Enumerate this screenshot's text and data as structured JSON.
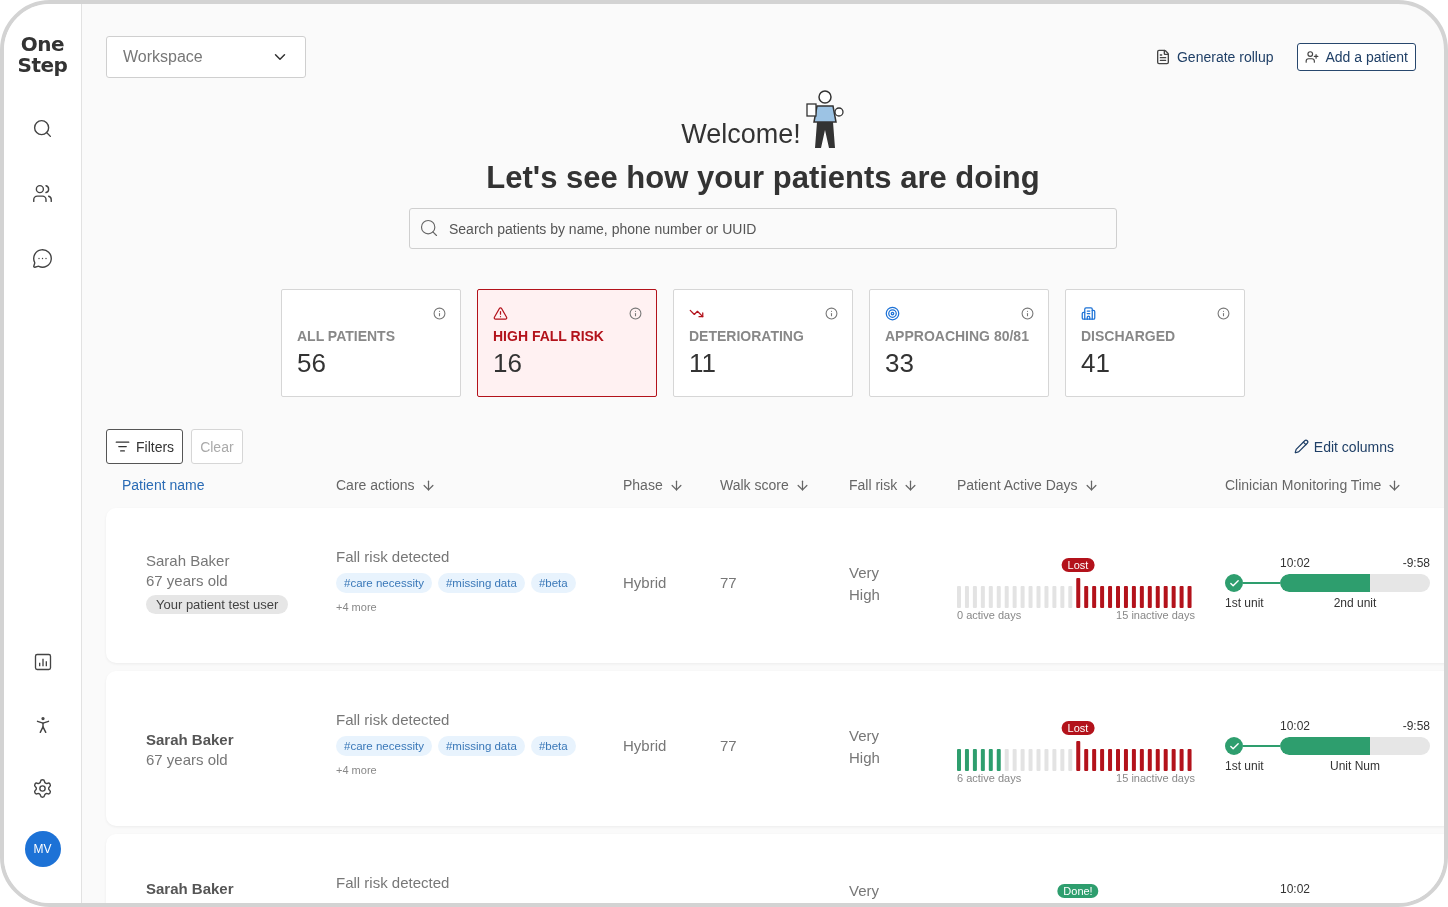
{
  "sidebar": {
    "logo_lines": [
      "One",
      "Step"
    ],
    "avatar": "MV"
  },
  "workspace": {
    "placeholder": "Workspace"
  },
  "actions": [
    {
      "kind": "link",
      "label": "Generate rollup"
    },
    {
      "kind": "outlined",
      "label": "Add a patient"
    }
  ],
  "welcome": "Welcome!",
  "heading": "Let's see how your patients are doing",
  "search": {
    "placeholder": "Search patients by name, phone number or UUID"
  },
  "stats": [
    {
      "kind": "all",
      "label": "ALL PATIENTS",
      "value": "56",
      "selected": false
    },
    {
      "kind": "fall",
      "label": "HIGH FALL RISK",
      "value": "16",
      "selected": true
    },
    {
      "kind": "deteriorating",
      "label": "DETERIORATING",
      "value": "11",
      "selected": false
    },
    {
      "kind": "approaching",
      "label": "APPROACHING 80/81",
      "value": "33",
      "selected": false
    },
    {
      "kind": "discharged",
      "label": "DISCHARGED",
      "value": "41",
      "selected": false
    }
  ],
  "filter_buttons": [
    {
      "kind": "filters",
      "label": "Filters",
      "disabled": false
    },
    {
      "kind": "clear",
      "label": "Clear",
      "disabled": true
    }
  ],
  "edit_columns": "Edit columns",
  "columns": [
    {
      "label": "Patient name",
      "selected": true
    },
    {
      "label": "Care actions",
      "selected": false
    },
    {
      "label": "Phase",
      "selected": false
    },
    {
      "label": "Walk score",
      "selected": false
    },
    {
      "label": "Fall risk",
      "selected": false
    },
    {
      "label": "Patient Active Days",
      "selected": false
    },
    {
      "label": "Clinician Monitoring Time",
      "selected": false
    }
  ],
  "rows": [
    {
      "name": "Sarah Baker",
      "age": "67 years old",
      "emphasized": false,
      "badge": "Your patient test user",
      "care_action": "Fall risk detected",
      "tags": [
        "#care necessity",
        "#missing data",
        "#beta"
      ],
      "more": "+4 more",
      "phase": "Hybrid",
      "walk_score": "77",
      "fall_risk": "Very High",
      "days": {
        "badge": "Lost",
        "kind": "lost",
        "level": 0,
        "active_label": "0 active days",
        "inactive_label": "15 inactive days"
      },
      "monitoring": {
        "done": true,
        "level": 0.6,
        "time": "10:02",
        "remaining": "-9:58",
        "first_label": "1st unit",
        "second_label": "2nd unit"
      }
    },
    {
      "name": "Sarah Baker",
      "age": "67 years old",
      "emphasized": true,
      "care_action": "Fall risk detected",
      "tags": [
        "#care necessity",
        "#missing data",
        "#beta"
      ],
      "more": "+4 more",
      "phase": "Hybrid",
      "walk_score": "77",
      "fall_risk": "Very High",
      "days": {
        "badge": "Lost",
        "kind": "lost",
        "level": 0.2,
        "active_label": "6 active days",
        "inactive_label": "15 inactive days"
      },
      "monitoring": {
        "done": true,
        "level": 0.6,
        "time": "10:02",
        "remaining": "-9:58",
        "first_label": "1st unit",
        "second_label": "Unit Num"
      }
    },
    {
      "name": "Sarah Baker",
      "emphasized": true,
      "care_action": "Fall risk detected",
      "fall_risk": "Very",
      "days": {
        "badge": "Done!",
        "kind": "done"
      },
      "monitoring": {
        "time": "10:02"
      }
    }
  ]
}
